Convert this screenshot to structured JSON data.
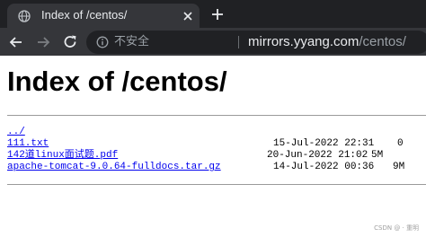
{
  "tab": {
    "title": "Index of /centos/",
    "favicon": "globe-icon",
    "close_icon": "close-icon"
  },
  "new_tab_icon": "plus-icon",
  "toolbar": {
    "back_icon": "back-arrow-icon",
    "forward_icon": "forward-arrow-icon",
    "reload_icon": "reload-icon",
    "security_icon": "info-icon",
    "security_label": "不安全",
    "url_host": "mirrors.yyang.com",
    "url_path": "/centos/"
  },
  "page": {
    "title": "Index of /centos/",
    "entries": [
      {
        "name": "../",
        "date": "",
        "size": ""
      },
      {
        "name": "111.txt",
        "date": "15-Jul-2022 22:31",
        "size": "0"
      },
      {
        "name": "142道linux面试题.pdf",
        "date": "20-Jun-2022 21:02",
        "size": "5M"
      },
      {
        "name": "apache-tomcat-9.0.64-fulldocs.tar.gz",
        "date": "14-Jul-2022 00:36",
        "size": "9M"
      }
    ]
  },
  "watermark": "CSDN @ · 重明",
  "colors": {
    "chrome_dark": "#202124",
    "chrome_tab": "#35363a",
    "link": "#0000ee"
  }
}
